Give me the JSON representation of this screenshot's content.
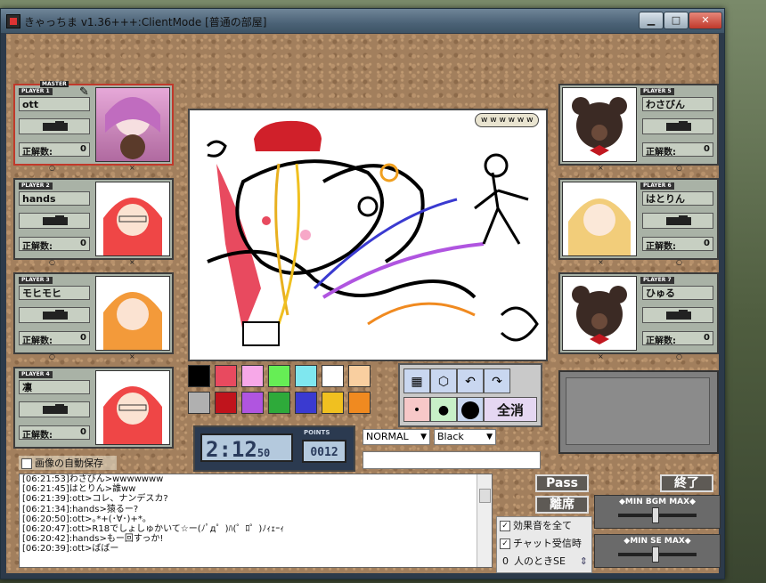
{
  "window": {
    "title": "きゃっちま v1.36+++:ClientMode [普通の部屋]"
  },
  "players": [
    {
      "tag": "PLAYER 1",
      "role": "MASTER",
      "name": "ott",
      "score_label": "正解数:",
      "score": "0",
      "mark_left": "○",
      "mark_right": "×"
    },
    {
      "tag": "PLAYER 2",
      "name": "hands",
      "score_label": "正解数:",
      "score": "0",
      "mark_left": "○",
      "mark_right": "×"
    },
    {
      "tag": "PLAYER 3",
      "name": "モヒモヒ",
      "score_label": "正解数:",
      "score": "0",
      "mark_left": "○",
      "mark_right": "×"
    },
    {
      "tag": "PLAYER 4",
      "name": "凛",
      "score_label": "正解数:",
      "score": "0",
      "mark_left": "○",
      "mark_right": "×"
    },
    {
      "tag": "PLAYER 5",
      "name": "わさびん",
      "score_label": "正解数:",
      "score": "0",
      "mark_left": "○",
      "mark_right": "×"
    },
    {
      "tag": "PLAYER 6",
      "name": "はとりん",
      "score_label": "正解数:",
      "score": "0",
      "mark_left": "○",
      "mark_right": "×"
    },
    {
      "tag": "PLAYER 7",
      "name": "ひゅる",
      "score_label": "正解数:",
      "score": "0",
      "mark_left": "○",
      "mark_right": "×"
    }
  ],
  "canvas": {
    "speech": "w w w w w w"
  },
  "palette": [
    "#000000",
    "#e84a5f",
    "#f7a8e8",
    "#66ee55",
    "#7fe7ef",
    "#ffffff",
    "#f9cfa0",
    "#b0b0b0",
    "#c0141c",
    "#b055e0",
    "#2eaa3a",
    "#3a3ad0",
    "#f0c020",
    "#f08a20"
  ],
  "tools": {
    "all_clear": "全消"
  },
  "timer": {
    "minutes": "2",
    "seconds": "12",
    "hundredths": "50",
    "points_label": "POINTS",
    "points": "0012"
  },
  "dropdowns": {
    "mode": "NORMAL",
    "color": "Black"
  },
  "autosave": {
    "label": "画像の自動保存",
    "checked": false
  },
  "chat_log": [
    "[06:21:53]わさびん>wwwwwww",
    "[06:21:45]はとりん>誰ww",
    "[06:21:39]:ott>コレ、ナンデスカ?",
    "[06:21:34]:hands>猿るー?",
    "[06:20:50]:ott>｡*+(･∀･)+*｡",
    "[06:20:47]:ott>R18でしょしゅかいて☆ー(ﾉﾟд゜)ﾊ(゜ﾛ゜)ﾉｨｪｰｨ",
    "[06:20:42]:hands>もー回すっか!",
    "[06:20:39]:ott>ばばー"
  ],
  "buttons": {
    "pass": "Pass",
    "leave": "離席",
    "end": "終了"
  },
  "options": {
    "sfx_all": "効果音を全て",
    "chat_receive": "チャット受信時",
    "count": "0",
    "se_label": "人のときSE"
  },
  "sliders": {
    "bgm": "◆MIN  BGM  MAX◆",
    "se": "◆MIN  SE  MAX◆"
  }
}
